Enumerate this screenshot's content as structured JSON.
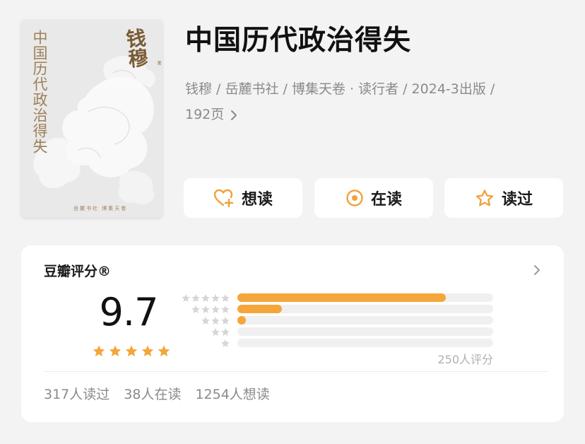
{
  "book": {
    "title": "中国历代政治得失",
    "meta_line1": "钱穆 / 岳麓书社 / 博集天卷 · 读行者 / 2024-3出版 /",
    "meta_line2": "192页"
  },
  "cover": {
    "title": "中国历代政治得失",
    "author_calligraphy": "钱穆",
    "author_note": "著",
    "publisher": "岳麓书社 博集天卷"
  },
  "actions": [
    {
      "label": "想读",
      "icon": "heart-plus-icon"
    },
    {
      "label": "在读",
      "icon": "target-circle-icon"
    },
    {
      "label": "读过",
      "icon": "star-outline-icon"
    }
  ],
  "rating": {
    "label": "豆瓣评分®",
    "score": "9.7",
    "score_stars": 5,
    "count_text": "250人评分",
    "distribution": [
      {
        "stars": 5,
        "fraction": 0.815
      },
      {
        "stars": 4,
        "fraction": 0.175
      },
      {
        "stars": 3,
        "fraction": 0.032
      },
      {
        "stars": 2,
        "fraction": 0.0
      },
      {
        "stars": 1,
        "fraction": 0.0
      }
    ]
  },
  "stats": {
    "read": "317人读过",
    "reading": "38人在读",
    "want": "1254人想读"
  },
  "colors": {
    "accent": "#f5a63b",
    "muted_text": "#8a8a8a",
    "cover_gold": "#9d8058"
  }
}
